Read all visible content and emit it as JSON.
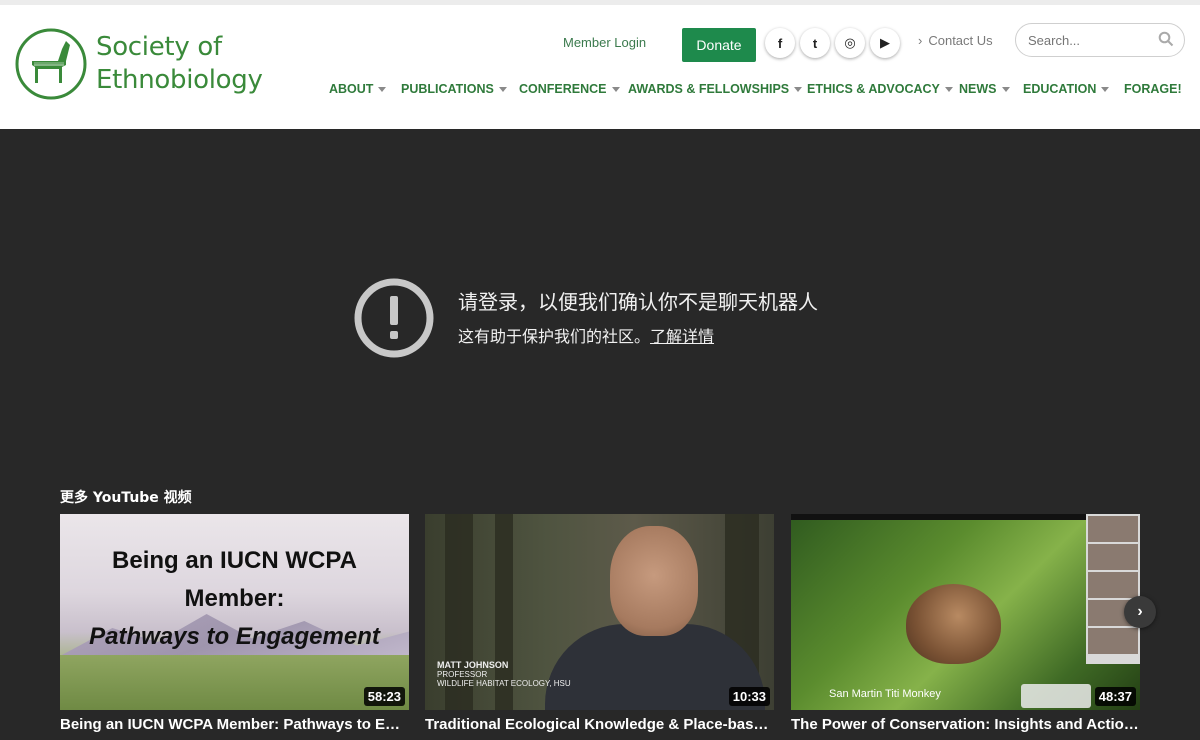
{
  "site": {
    "name_line1": "Society of",
    "name_line2": "Ethnobiology",
    "brand_color": "#3a8a3a"
  },
  "header": {
    "member_login": "Member Login",
    "donate": "Donate",
    "social": [
      {
        "icon": "facebook-icon",
        "glyph": "f"
      },
      {
        "icon": "twitter-icon",
        "glyph": "t"
      },
      {
        "icon": "instagram-icon",
        "glyph": "◎"
      },
      {
        "icon": "youtube-icon",
        "glyph": "▶"
      }
    ],
    "contact": "Contact Us",
    "search_placeholder": "Search..."
  },
  "nav": [
    {
      "label": "ABOUT",
      "has_dropdown": true
    },
    {
      "label": "PUBLICATIONS",
      "has_dropdown": true
    },
    {
      "label": "CONFERENCE",
      "has_dropdown": true
    },
    {
      "label": "AWARDS & FELLOWSHIPS",
      "has_dropdown": true
    },
    {
      "label": "ETHICS & ADVOCACY",
      "has_dropdown": true
    },
    {
      "label": "NEWS",
      "has_dropdown": true
    },
    {
      "label": "EDUCATION",
      "has_dropdown": true
    },
    {
      "label": "FORAGE!",
      "has_dropdown": false
    }
  ],
  "player": {
    "message_title": "请登录，以便我们确认你不是聊天机器人",
    "message_sub": "这有助于保护我们的社区。",
    "learn_more": "了解详情",
    "more_videos": "更多 YouTube 视频",
    "videos": [
      {
        "title": "Being an IUCN WCPA Member: Pathways to En…",
        "duration": "58:23",
        "thumb_line1": "Being an IUCN WCPA",
        "thumb_line2": "Member:",
        "thumb_line3": "Pathways to Engagement"
      },
      {
        "title": "Traditional Ecological Knowledge & Place-base…",
        "duration": "10:33",
        "lower_name": "MATT JOHNSON",
        "lower_role": "PROFESSOR",
        "lower_dept": "WILDLIFE HABITAT ECOLOGY, HSU"
      },
      {
        "title": "The Power of Conservation: Insights and Actio…",
        "duration": "48:37",
        "caption": "San Martin Titi Monkey"
      }
    ]
  }
}
